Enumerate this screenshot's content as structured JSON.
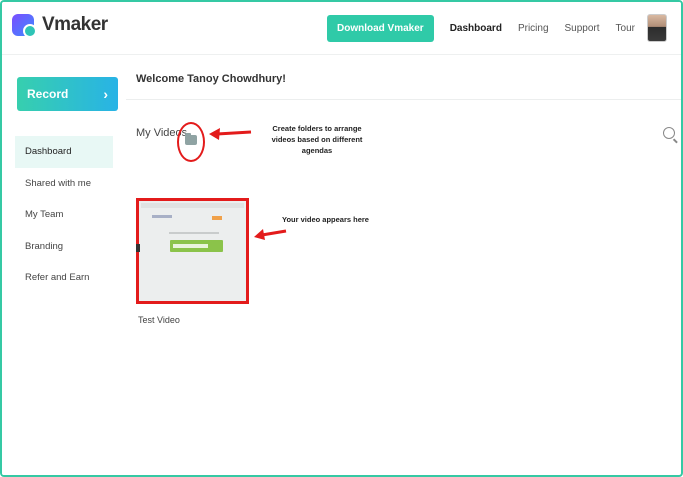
{
  "app": {
    "name": "Vmaker"
  },
  "header": {
    "download_label": "Download Vmaker",
    "nav": [
      {
        "label": "Dashboard",
        "active": true
      },
      {
        "label": "Pricing"
      },
      {
        "label": "Support"
      },
      {
        "label": "Tour"
      }
    ]
  },
  "sidebar": {
    "record_label": "Record",
    "record_chevron": "›",
    "items": [
      {
        "label": "Dashboard",
        "active": true
      },
      {
        "label": "Shared with me"
      },
      {
        "label": "My Team"
      },
      {
        "label": "Branding"
      },
      {
        "label": "Refer and Earn"
      }
    ]
  },
  "main": {
    "welcome": "Welcome Tanoy Chowdhury!",
    "section_title": "My Videos",
    "annotation_folders": "Create folders to arrange videos based on different agendas",
    "annotation_video": "Your video appears here",
    "videos": [
      {
        "title": "Test Video"
      }
    ]
  },
  "colors": {
    "accent": "#2fcaa8",
    "annotation": "#e31b1b",
    "frame": "#35c9a4"
  },
  "icons": {
    "search": "search-icon",
    "folder": "folder-icon",
    "avatar": "avatar"
  }
}
